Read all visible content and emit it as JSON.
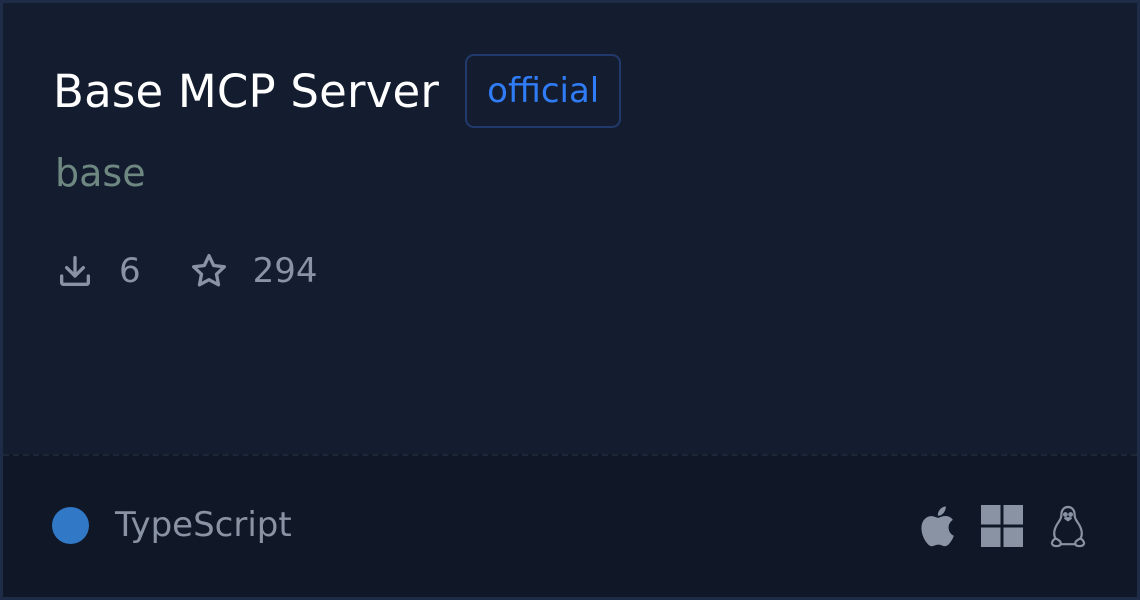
{
  "server": {
    "name": "Base MCP Server",
    "badge": "official",
    "slug": "base"
  },
  "stats": {
    "downloads": "6",
    "stars": "294"
  },
  "footer": {
    "language": "TypeScript",
    "language_color": "#3178c6",
    "platforms": [
      "apple-icon",
      "windows-icon",
      "linux-icon"
    ]
  },
  "colors": {
    "background": "#141d2f",
    "footer_background": "#101827",
    "badge_text": "#2f7cf6",
    "badge_border": "#22396b",
    "subtitle": "#6e8781",
    "muted": "#8a93a3"
  }
}
